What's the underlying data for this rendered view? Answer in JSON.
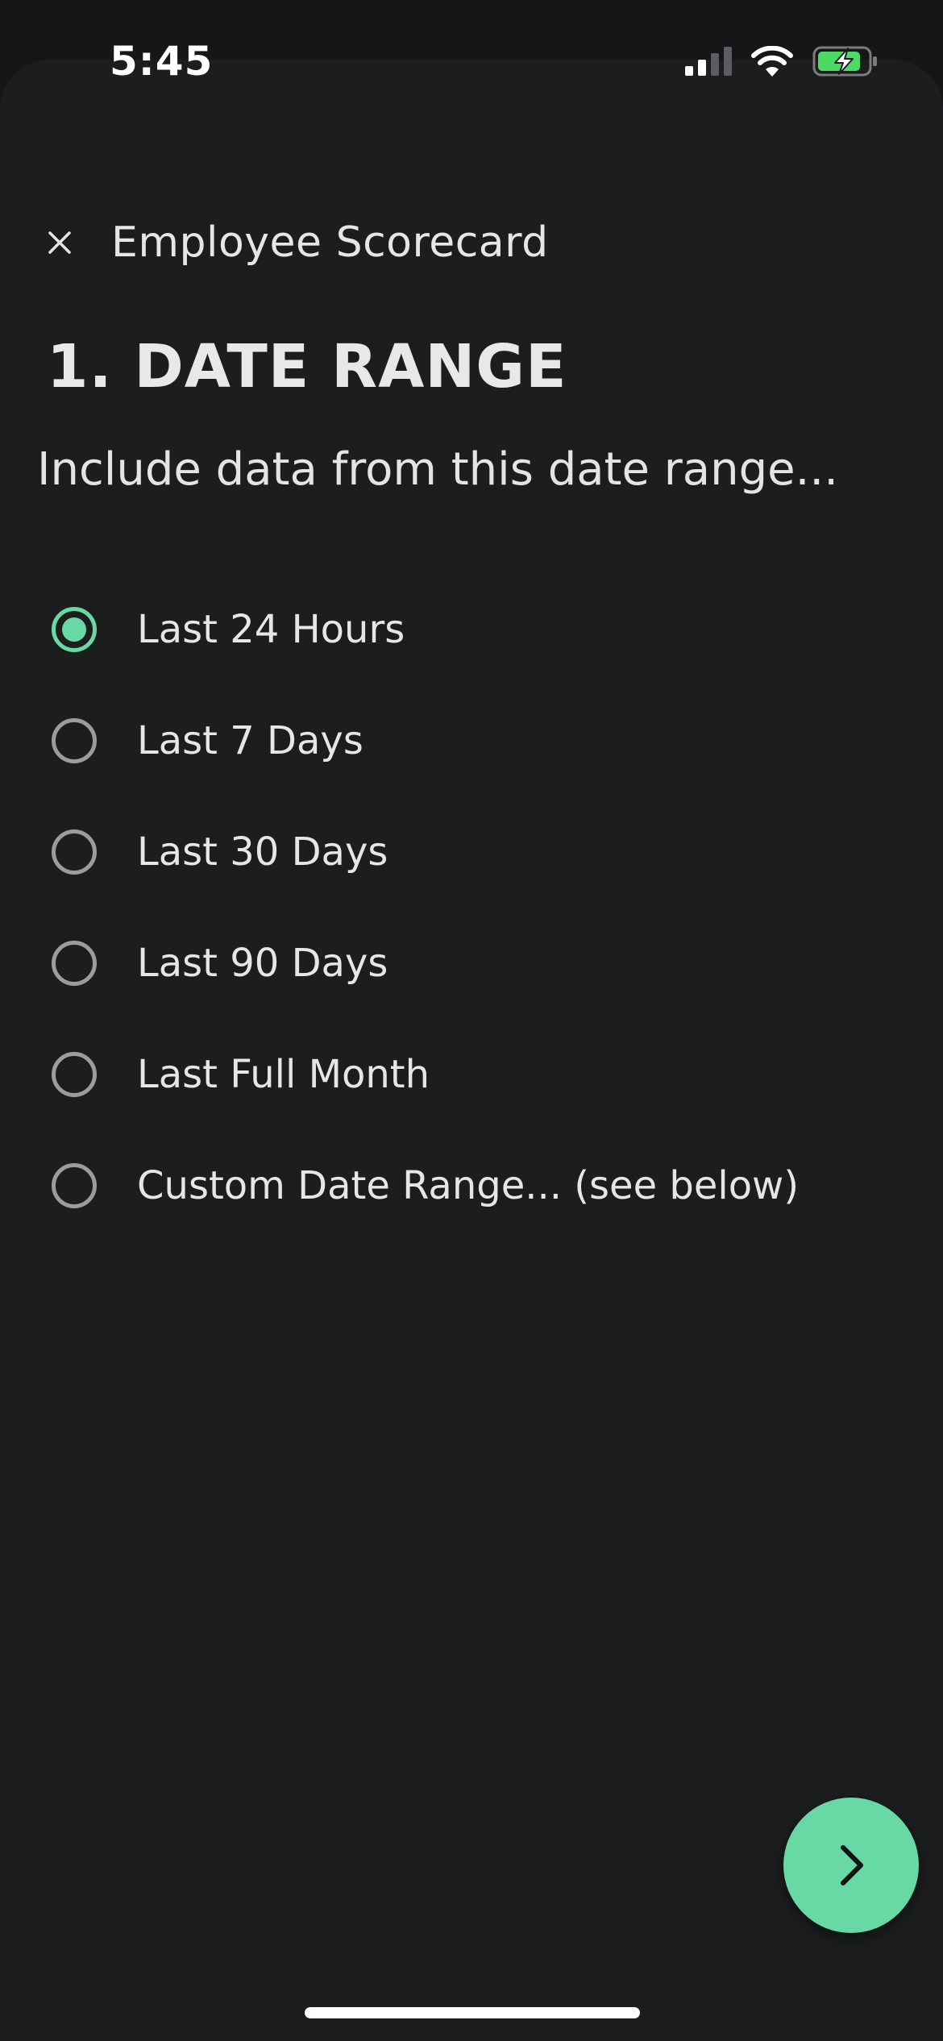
{
  "status_bar": {
    "time": "5:45",
    "icons": [
      "cellular-signal-icon",
      "wifi-icon",
      "battery-charging-icon"
    ]
  },
  "header": {
    "close_icon": "close-icon",
    "title": "Employee Scorecard"
  },
  "section": {
    "title": "1. DATE RANGE",
    "subtitle": "Include data from this date range..."
  },
  "options": [
    {
      "label": "Last 24 Hours",
      "selected": true
    },
    {
      "label": "Last 7 Days",
      "selected": false
    },
    {
      "label": "Last 30 Days",
      "selected": false
    },
    {
      "label": "Last 90 Days",
      "selected": false
    },
    {
      "label": "Last Full Month",
      "selected": false
    },
    {
      "label": "Custom Date Range... (see below)",
      "selected": false
    }
  ],
  "fab": {
    "icon": "chevron-right-icon"
  },
  "colors": {
    "accent": "#68d9a4",
    "background": "#1b1d1f",
    "text": "#e6e6e6",
    "radio_unselected": "#9a9c9e"
  }
}
